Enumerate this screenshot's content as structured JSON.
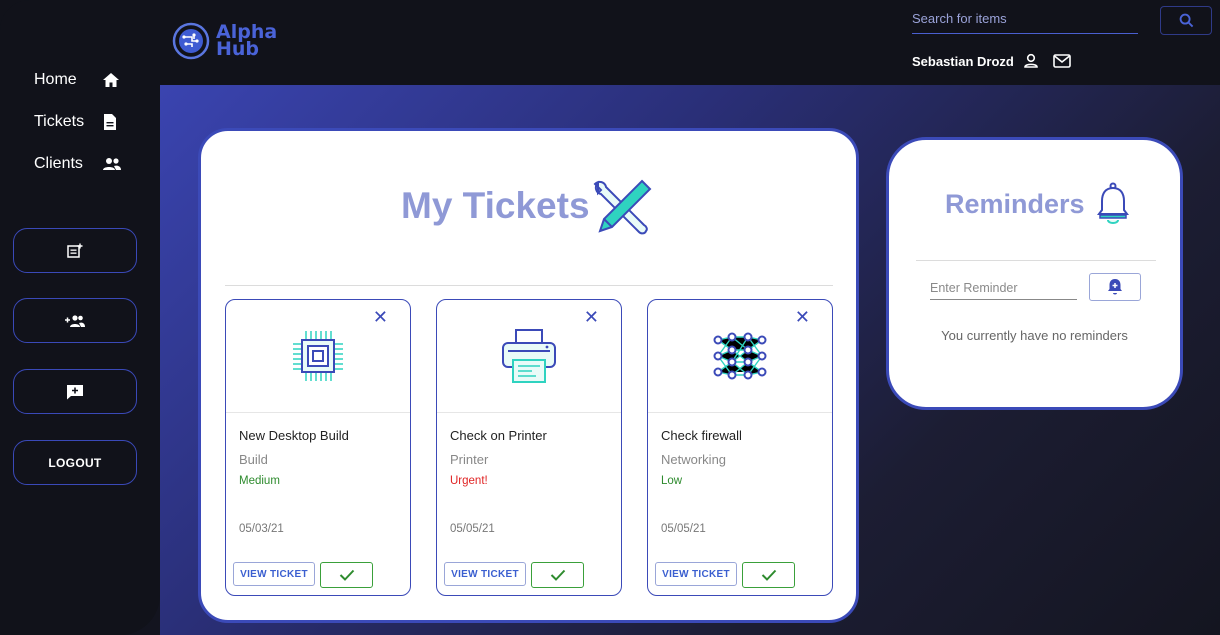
{
  "app": {
    "logo_line1": "Alpha",
    "logo_line2": "Hub"
  },
  "header": {
    "search_placeholder": "Search for items",
    "user_name": "Sebastian Drozd"
  },
  "sidebar": {
    "nav": [
      {
        "label": "Home",
        "icon": "home-icon"
      },
      {
        "label": "Tickets",
        "icon": "document-icon"
      },
      {
        "label": "Clients",
        "icon": "people-icon"
      }
    ],
    "buttons": [
      {
        "icon": "new-note-icon"
      },
      {
        "icon": "add-user-icon"
      },
      {
        "icon": "add-comment-icon"
      },
      {
        "label": "LOGOUT"
      }
    ]
  },
  "tickets": {
    "title": "My Tickets",
    "cards": [
      {
        "title": "New Desktop Build",
        "category": "Build",
        "priority": "Medium",
        "priority_color": "#2e8b2e",
        "date": "05/03/21",
        "icon": "cpu-chip-icon",
        "view_label": "VIEW TICKET"
      },
      {
        "title": "Check on Printer",
        "category": "Printer",
        "priority": "Urgent!",
        "priority_color": "#e02424",
        "date": "05/05/21",
        "icon": "printer-icon",
        "view_label": "VIEW TICKET"
      },
      {
        "title": "Check firewall",
        "category": "Networking",
        "priority": "Low",
        "priority_color": "#2e8b2e",
        "date": "05/05/21",
        "icon": "neural-network-icon",
        "view_label": "VIEW TICKET"
      }
    ]
  },
  "reminders": {
    "title": "Reminders",
    "input_placeholder": "Enter Reminder",
    "empty_text": "You currently have no reminders"
  },
  "colors": {
    "accent": "#3b4ab8",
    "title": "#8f99d6",
    "teal": "#2fd3c0"
  }
}
